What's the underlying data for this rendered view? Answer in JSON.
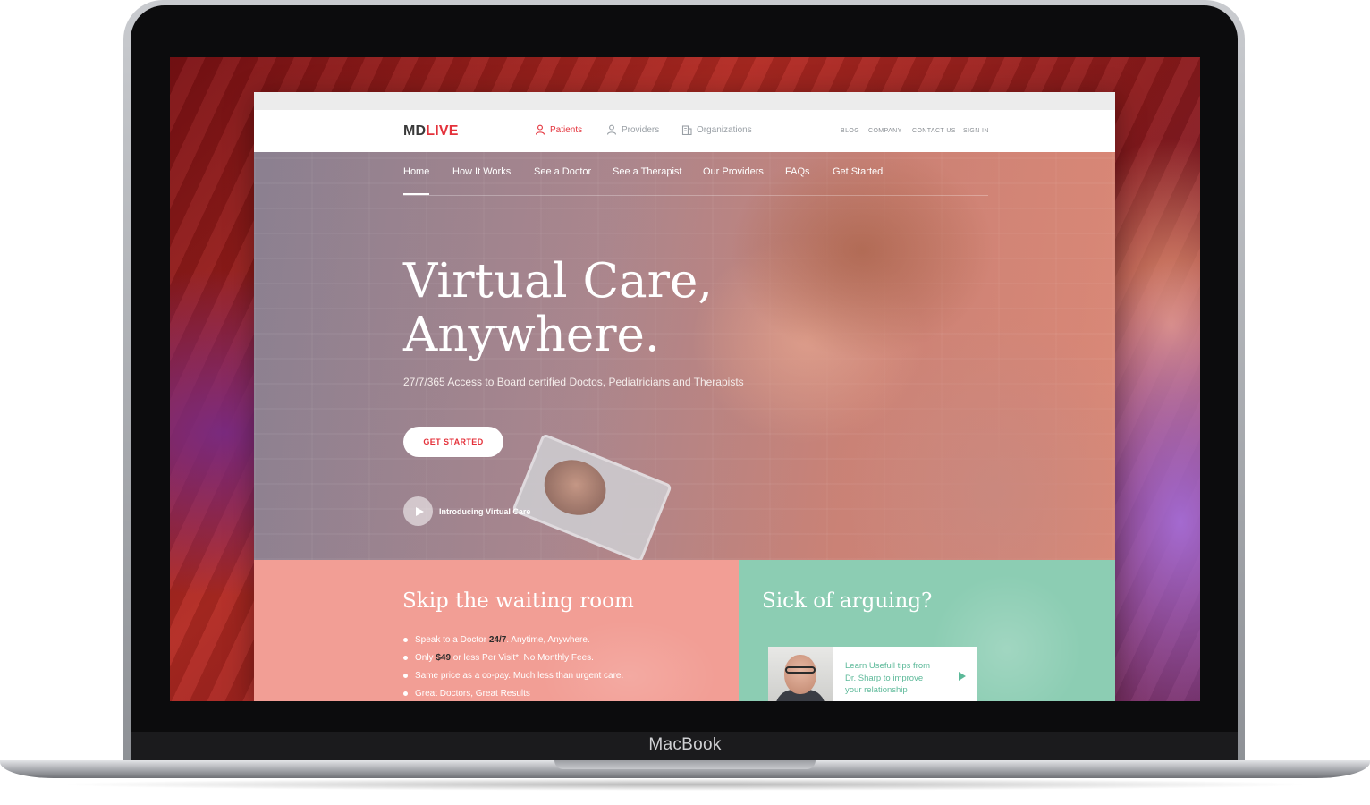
{
  "device": {
    "brand": "MacBook"
  },
  "header": {
    "logo": {
      "part1": "MD",
      "part2": "LIVE"
    },
    "audience_tabs": [
      {
        "label": "Patients",
        "icon": "person-icon",
        "active": true
      },
      {
        "label": "Providers",
        "icon": "person-icon",
        "active": false
      },
      {
        "label": "Organizations",
        "icon": "building-icon",
        "active": false
      }
    ],
    "utility_links": [
      "BLOG",
      "COMPANY",
      "CONTACT US",
      "SIGN IN"
    ]
  },
  "subnav": {
    "items": [
      "Home",
      "How It Works",
      "See a Doctor",
      "See a Therapist",
      "Our Providers",
      "FAQs",
      "Get Started"
    ],
    "active": "Home"
  },
  "hero": {
    "title_line1": "Virtual Care,",
    "title_line2": "Anywhere.",
    "subtitle": "27/7/365 Access to Board certified Doctos, Pediatricians and Therapists",
    "cta_label": "GET STARTED",
    "video_label": "Introducing Virtual Care"
  },
  "card_left": {
    "title": "Skip the waiting room",
    "items": [
      {
        "before": "Speak to a Doctor ",
        "bold": "24/7",
        "after": ". Anytime, Anywhere."
      },
      {
        "before": "Only ",
        "bold": "$49",
        "after": " or less Per Visit*. No Monthly Fees."
      },
      {
        "before": "Same price as a co-pay. Much less than urgent care.",
        "bold": "",
        "after": ""
      },
      {
        "before": "Great Doctors, Great Results",
        "bold": "",
        "after": ""
      }
    ]
  },
  "card_right": {
    "title": "Sick of arguing?",
    "tip_line1": "Learn Usefull tips from",
    "tip_line2": "Dr. Sharp to improve",
    "tip_line3": "your relationship"
  },
  "colors": {
    "brand_red": "#e4323b",
    "coral_card": "#f29e95",
    "mint_card": "#8ccdb3",
    "mint_text": "#5cb999"
  }
}
